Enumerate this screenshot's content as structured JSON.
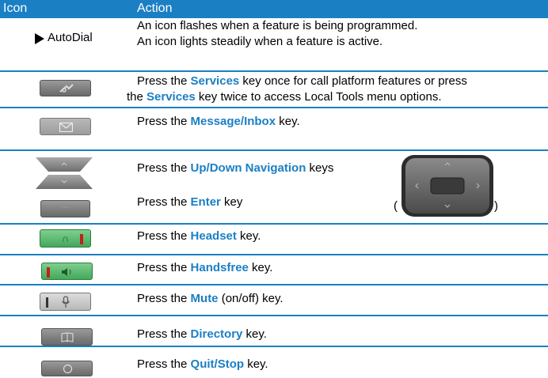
{
  "header": {
    "icon_col": "Icon",
    "action_col": "Action"
  },
  "rows": {
    "autodial": {
      "icon_label": "AutoDial",
      "line1": "An icon flashes when a feature is being programmed.",
      "line2": "An icon lights steadily when a feature is active."
    },
    "services": {
      "l1_pre": "Press the ",
      "l1_kw": "Services",
      "l1_post": " key once for call platform features or press",
      "l2_pre": "the ",
      "l2_kw": "Services",
      "l2_post": " key twice to access Local Tools menu options."
    },
    "message": {
      "pre": "Press the ",
      "kw": "Message/Inbox",
      "post": " key."
    },
    "navigation": {
      "pre": "Press the ",
      "kw": "Up/Down Navigation",
      "post": " keys"
    },
    "enter": {
      "pre": "Press the ",
      "kw": "Enter",
      "post": " key",
      "paren_open": "(",
      "paren_close": ")"
    },
    "headset": {
      "pre": "Press the ",
      "kw": "Headset",
      "post": " key."
    },
    "handsfree": {
      "pre": "Press the ",
      "kw": "Handsfree",
      "post": " key."
    },
    "mute": {
      "pre": "Press the ",
      "kw": "Mute",
      "post": " (on/off) key."
    },
    "directory": {
      "pre": "Press the ",
      "kw": "Directory",
      "post": " key."
    },
    "quit": {
      "pre": "Press the ",
      "kw": "Quit/Stop",
      "post": " key."
    }
  },
  "colors": {
    "accent": "#1b7fc4",
    "key_gray": "#8a8a8a",
    "key_green": "#4caf63",
    "indicator_red": "#c0211b"
  },
  "icons": [
    "arrow-right-icon",
    "services-key-icon",
    "envelope-icon",
    "nav-up-down-keys-icon",
    "enter-key-icon",
    "navigation-cluster-icon",
    "headset-key-icon",
    "handsfree-key-icon",
    "mute-key-icon",
    "directory-key-icon",
    "quit-stop-key-icon"
  ]
}
